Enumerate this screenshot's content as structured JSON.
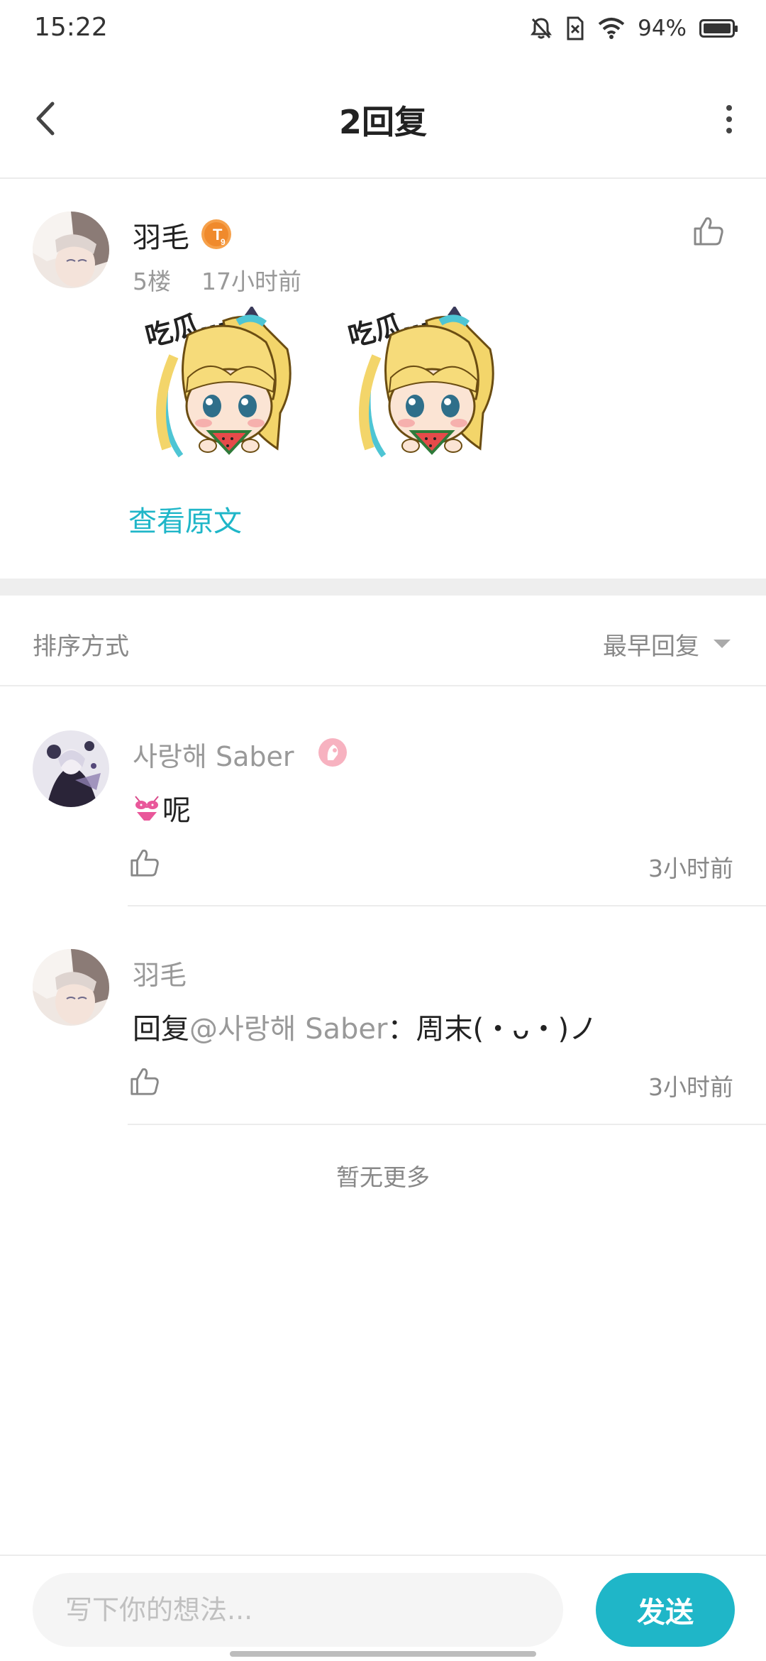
{
  "status_bar": {
    "time": "15:22",
    "battery_text": "94%",
    "battery_level": 0.94
  },
  "nav": {
    "title": "2回复"
  },
  "post": {
    "author": "羽毛",
    "level_badge": "T9",
    "floor": "5楼",
    "time_ago": "17小时前",
    "sticker_text": "吃瓜…",
    "view_original": "查看原文"
  },
  "sort": {
    "label": "排序方式",
    "value": "最早回复"
  },
  "replies": [
    {
      "author": "사랑해 Saber",
      "content": "呢",
      "time": "3小时前"
    },
    {
      "author": "羽毛",
      "prefix": "回复",
      "mention": "@사랑해 Saber",
      "content": "：周末(・ᴗ・)ノ",
      "time": "3小时前"
    }
  ],
  "no_more": "暂无更多",
  "composer": {
    "placeholder": "写下你的想法...",
    "send_label": "发送"
  },
  "colors": {
    "accent": "#1fb6c8",
    "muted": "#999999",
    "divider": "#eeeeee"
  }
}
